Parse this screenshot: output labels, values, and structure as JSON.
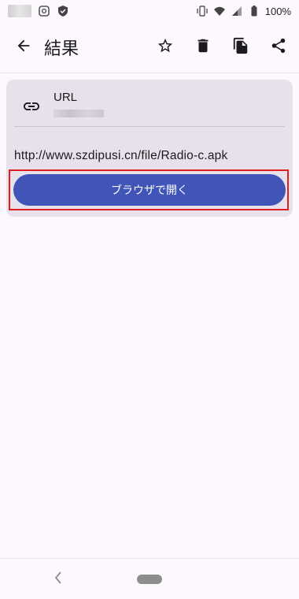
{
  "status_bar": {
    "battery": "100%"
  },
  "app_bar": {
    "title": "結果",
    "icons": [
      "back-arrow-icon",
      "star-icon",
      "delete-icon",
      "copy-icon",
      "share-icon"
    ]
  },
  "result_card": {
    "type_label": "URL",
    "url": "http://www.szdipusi.cn/file/Radio-c.apk",
    "open_button_label": "ブラウザで開く"
  },
  "colors": {
    "background": "#fcf8fd",
    "card": "#e6e1ea",
    "button": "#4154b8",
    "highlight": "#e21d1d"
  }
}
